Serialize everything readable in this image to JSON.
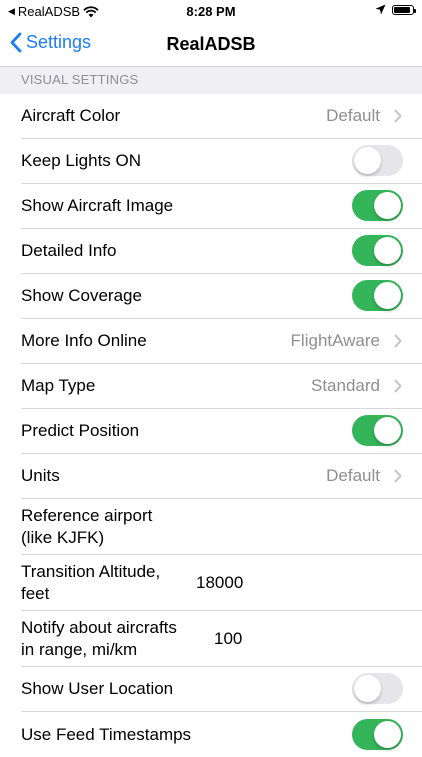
{
  "status_bar": {
    "back_app": "RealADSB",
    "time": "8:28 PM"
  },
  "nav": {
    "back_label": "Settings",
    "title": "RealADSB"
  },
  "section": {
    "title": "VISUAL SETTINGS"
  },
  "rows": {
    "aircraft_color": {
      "label": "Aircraft Color",
      "value": "Default"
    },
    "keep_lights": {
      "label": "Keep Lights ON",
      "on": false
    },
    "show_aircraft_image": {
      "label": "Show Aircraft Image",
      "on": true
    },
    "detailed_info": {
      "label": "Detailed Info",
      "on": true
    },
    "show_coverage": {
      "label": "Show Coverage",
      "on": true
    },
    "more_info_online": {
      "label": "More Info Online",
      "value": "FlightAware"
    },
    "map_type": {
      "label": "Map Type",
      "value": "Standard"
    },
    "predict_position": {
      "label": "Predict Position",
      "on": true
    },
    "units": {
      "label": "Units",
      "value": "Default"
    },
    "reference_airport": {
      "label_line1": "Reference airport",
      "label_line2": "(like KJFK)",
      "value": ""
    },
    "transition_altitude": {
      "label_line1": "Transition Altitude,",
      "label_line2": "feet",
      "value": "18000"
    },
    "notify_range": {
      "label_line1": "Notify about aircrafts",
      "label_line2": "in range, mi/km",
      "value": "100"
    },
    "show_user_location": {
      "label": "Show User Location",
      "on": false
    },
    "use_feed_timestamps": {
      "label": "Use Feed Timestamps",
      "on": true
    }
  },
  "colors": {
    "accent": "#1c7cf4",
    "toggle_on": "#34b559",
    "toggle_off": "#e5e5ea",
    "secondary_text": "#8e8e93"
  }
}
